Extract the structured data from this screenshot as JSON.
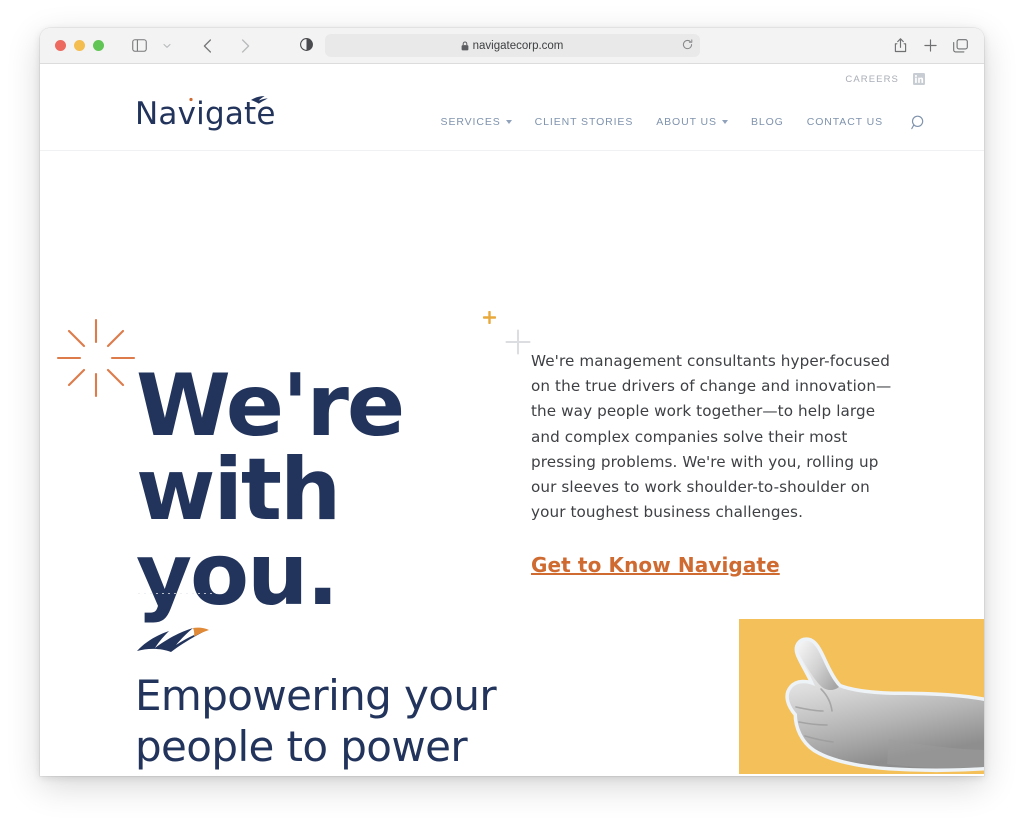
{
  "browser": {
    "traffic_lights": [
      "close",
      "minimize",
      "maximize"
    ],
    "sidebar_toggle": "sidebar-icon",
    "sidebar_caret": "chevron-down-icon",
    "back": "back-arrow-icon",
    "forward": "forward-arrow-icon",
    "reader_mode": "reader-mode-icon",
    "url": "navigatecorp.com",
    "lock": "lock-icon",
    "reload": "reload-icon",
    "share": "share-icon",
    "new_tab": "plus-icon",
    "tab_overview": "tabs-icon"
  },
  "site": {
    "utility": {
      "careers_label": "CAREERS",
      "linkedin_icon": "linkedin-icon"
    },
    "logo": {
      "text": "Navigate",
      "mark": "bird-swoosh-icon"
    },
    "nav": {
      "items": [
        {
          "label": "SERVICES",
          "has_caret": true
        },
        {
          "label": "CLIENT STORIES",
          "has_caret": false
        },
        {
          "label": "ABOUT US",
          "has_caret": true
        },
        {
          "label": "BLOG",
          "has_caret": false
        },
        {
          "label": "CONTACT US",
          "has_caret": false
        }
      ],
      "search_icon": "search-icon"
    },
    "hero": {
      "headline_line1": "We're",
      "headline_line2": "with you.",
      "paragraph": "We're management consultants hyper-focused on the true drivers of change and innovation—the way people work together—to help large and complex companies solve their most pressing problems. We're with you, rolling up our sleeves to work shoulder-to-shoulder on your toughest business challenges.",
      "cta_label": "Get to Know Navigate",
      "decorations": {
        "starburst": "starburst-icon",
        "plus_gold": "plus-icon-gold",
        "plus_grey": "plus-icon-grey",
        "dotted_rule": "dotted-divider"
      }
    },
    "section_two": {
      "bird_icon": "bird-icon",
      "headline": "Empowering your people to power",
      "image": {
        "alt": "thumbs-up-hand",
        "background_color": "#f3c05a"
      }
    }
  },
  "colors": {
    "navy": "#22345c",
    "orange": "#cf6a31",
    "amber": "#f3c05a",
    "nav_blue": "#7f93ad",
    "gold_plus": "#e8a93c",
    "grey_plus": "#dcdde0",
    "starburst_orange": "#dd7c4a"
  }
}
